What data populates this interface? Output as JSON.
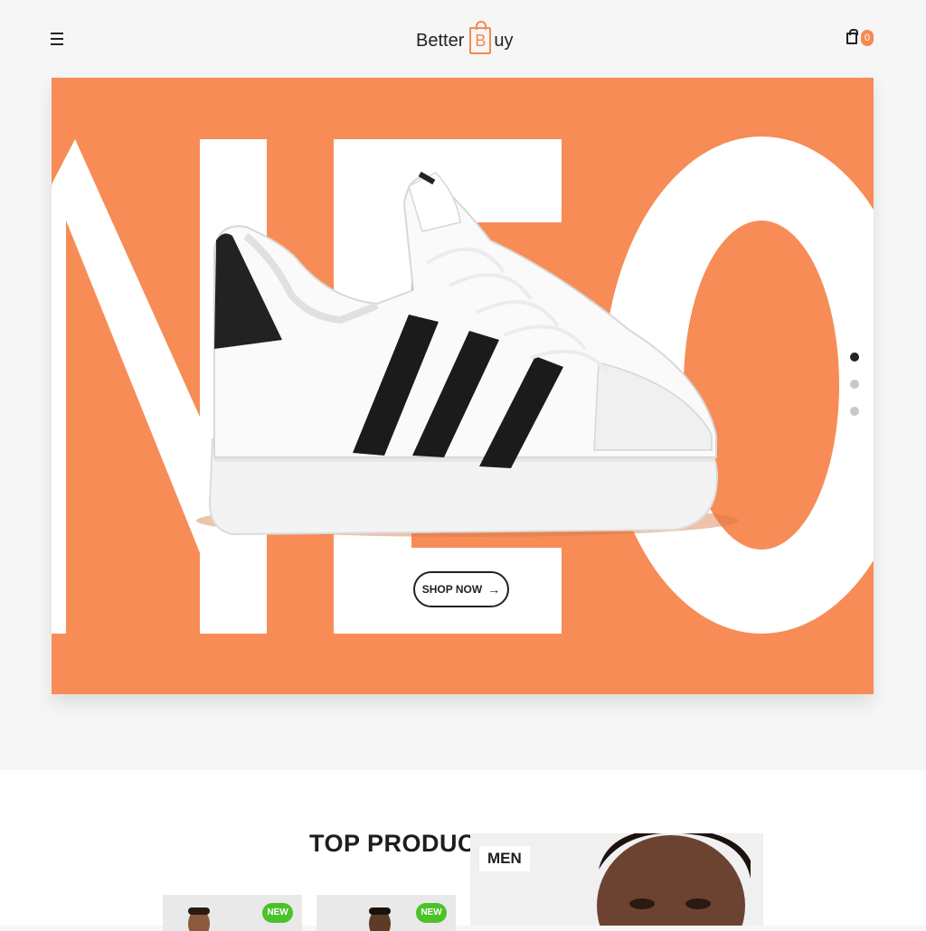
{
  "header": {
    "logo_before": "Better",
    "logo_letter": "B",
    "logo_after": "uy",
    "cart_count": "0",
    "menu_icon": "hamburger-menu-icon",
    "cart_icon": "shopping-bag-icon"
  },
  "hero": {
    "big_text": "NEO",
    "button_label": "SHOP NOW",
    "button_arrow": "→",
    "slides": 3,
    "active_slide": 1,
    "background_color": "#f78c57"
  },
  "products": {
    "section_title": "TOP PRODUCTS",
    "cards": [
      {
        "badge": "NEW"
      },
      {
        "badge": "NEW"
      }
    ],
    "category_label": "MEN"
  },
  "colors": {
    "accent": "#f5894f",
    "badge_green": "#4cc22a"
  }
}
